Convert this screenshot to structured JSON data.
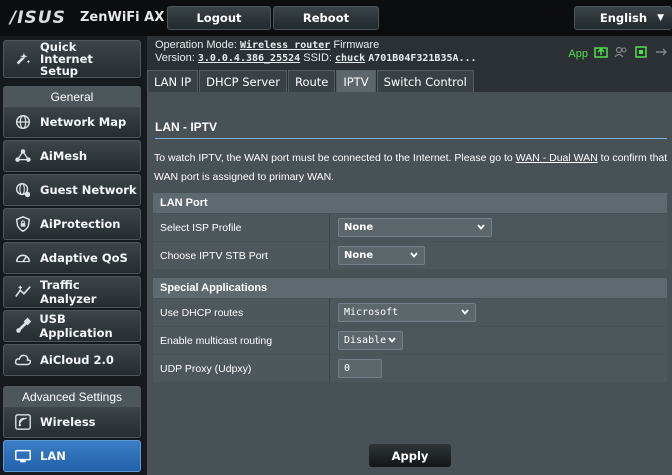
{
  "header": {
    "logo": "/ISUS",
    "model": "ZenWiFi AX",
    "logout": "Logout",
    "reboot": "Reboot",
    "language": "English"
  },
  "sidebar": {
    "quick_setup": "Quick Internet Setup",
    "general_heading": "General",
    "general_items": [
      {
        "label": "Network Map",
        "icon": "network-map-icon"
      },
      {
        "label": "AiMesh",
        "icon": "aimesh-icon"
      },
      {
        "label": "Guest Network",
        "icon": "guest-network-icon"
      },
      {
        "label": "AiProtection",
        "icon": "aiprotection-icon"
      },
      {
        "label": "Adaptive QoS",
        "icon": "adaptive-qos-icon"
      },
      {
        "label": "Traffic Analyzer",
        "icon": "traffic-analyzer-icon"
      },
      {
        "label": "USB Application",
        "icon": "usb-application-icon"
      },
      {
        "label": "AiCloud 2.0",
        "icon": "aicloud-icon"
      }
    ],
    "advanced_heading": "Advanced Settings",
    "advanced_items": [
      {
        "label": "Wireless",
        "icon": "wireless-icon"
      },
      {
        "label": "LAN",
        "icon": "lan-icon",
        "active": true
      }
    ]
  },
  "status": {
    "opmode_label": "Operation Mode:",
    "opmode_value": "Wireless router",
    "firmware_label": "Firmware",
    "version_label": "Version:",
    "version_value": "3.0.0.4.386_25524",
    "ssid_label": "SSID:",
    "ssid_value": "chuck",
    "ssid_extra": "A701B04F321B35A...",
    "app_label": "App"
  },
  "tabs": [
    "LAN IP",
    "DHCP Server",
    "Route",
    "IPTV",
    "Switch Control"
  ],
  "active_tab": "IPTV",
  "page": {
    "title": "LAN - IPTV",
    "desc_before": "To watch IPTV, the WAN port must be connected to the Internet. Please go to ",
    "desc_link": "WAN - Dual WAN",
    "desc_after": " to confirm that WAN port is assigned to primary WAN."
  },
  "lan_port": {
    "heading": "LAN Port",
    "isp_label": "Select ISP Profile",
    "isp_value": "None",
    "stb_label": "Choose IPTV STB Port",
    "stb_value": "None"
  },
  "special_apps": {
    "heading": "Special Applications",
    "dhcp_label": "Use DHCP routes",
    "dhcp_value": "Microsoft",
    "multicast_label": "Enable multicast routing",
    "multicast_value": "Disable",
    "udp_label": "UDP Proxy (Udpxy)",
    "udp_value": "0"
  },
  "apply_label": "Apply",
  "colors": {
    "accent_line": "#7bb1df",
    "status_green": "#4fe04f"
  }
}
